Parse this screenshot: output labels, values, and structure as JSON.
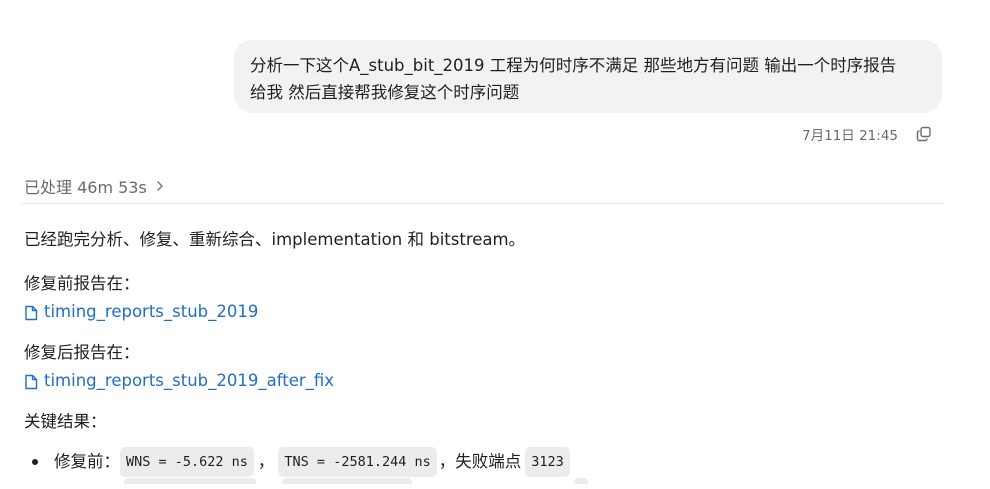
{
  "user_message": {
    "line1": "分析一下这个A_stub_bit_2019  工程为何时序不满足 那些地方有问题 输出一个时序报告",
    "line2": "给我 然后直接帮我修复这个时序问题",
    "timestamp": "7月11日 21:45",
    "copy_icon": "copy-icon"
  },
  "processed": {
    "label": "已处理 46m 53s",
    "chevron_icon": "chevron-right-icon"
  },
  "response": {
    "intro": "已经跑完分析、修复、重新综合、implementation 和 bitstream。",
    "before_label": "修复前报告在：",
    "before_link": "timing_reports_stub_2019",
    "after_label": "修复后报告在：",
    "after_link": "timing_reports_stub_2019_after_fix",
    "results_label": "关键结果：",
    "bullet1": {
      "prefix": "修复前：",
      "wns": "WNS = -5.622 ns",
      "sep1": "，",
      "tns": "TNS = -2581.244 ns",
      "sep2": "，失败端点",
      "endpoints": "3123"
    }
  },
  "colors": {
    "link": "#1f6fc5",
    "bubble": "#f2f2f2",
    "chip": "#ececec"
  }
}
